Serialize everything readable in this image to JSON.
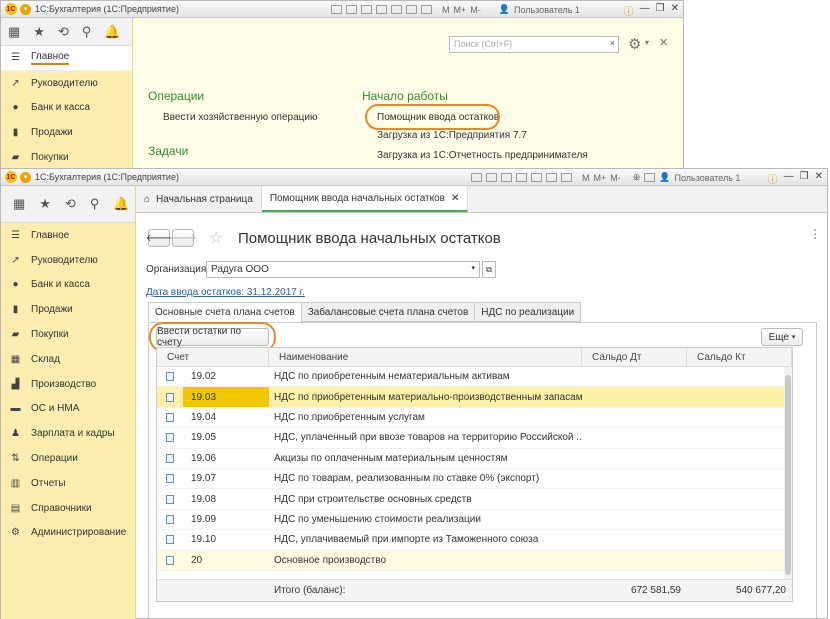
{
  "back_window": {
    "title": "1С:Бухгалтерия (1С:Предприятие)",
    "user": "Пользователь 1",
    "search_placeholder": "Поиск (Ctrl+F)",
    "sidebar": [
      "Главное",
      "Руководителю",
      "Банк и касса",
      "Продажи",
      "Покупки"
    ],
    "sections": {
      "operations_title": "Операции",
      "operations_link": "Ввести хозяйственную операцию",
      "tasks_title": "Задачи",
      "start_title": "Начало работы",
      "start_links": [
        "Помощник ввода остатков",
        "Загрузка из 1С:Предприятия 7.7",
        "Загрузка из 1С:Отчетность предпринимателя"
      ]
    }
  },
  "front_window": {
    "title": "1С:Бухгалтерия (1С:Предприятие)",
    "user": "Пользователь 1",
    "toolbar_text": [
      "M",
      "M+",
      "M-"
    ],
    "sidebar": [
      "Главное",
      "Руководителю",
      "Банк и касса",
      "Продажи",
      "Покупки",
      "Склад",
      "Производство",
      "ОС и НМА",
      "Зарплата и кадры",
      "Операции",
      "Отчеты",
      "Справочники",
      "Администрирование"
    ],
    "tabs": [
      "Начальная страница",
      "Помощник ввода начальных остатков"
    ],
    "page_title": "Помощник ввода начальных остатков",
    "org_label": "Организация:",
    "org_value": "Радуга ООО",
    "date_link": "Дата ввода остатков: 31.12.2017 г.",
    "subtabs": [
      "Основные счета плана счетов",
      "Забалансовые счета плана счетов",
      "НДС по реализации"
    ],
    "enter_button": "Ввести остатки по счету",
    "more_button": "Еще",
    "columns": [
      "Счет",
      "Наименование",
      "Сальдо Дт",
      "Сальдо Кт"
    ],
    "rows": [
      {
        "acc": "19.02",
        "name": "НДС по приобретенным нематериальным активам"
      },
      {
        "acc": "19.03",
        "name": "НДС по приобретенным материально-производственным запасам"
      },
      {
        "acc": "19.04",
        "name": "НДС по приобретенным услугам"
      },
      {
        "acc": "19.05",
        "name": "НДС, уплаченный при ввозе товаров на территорию Российской ..."
      },
      {
        "acc": "19.06",
        "name": "Акцизы по оплаченным материальным ценностям"
      },
      {
        "acc": "19.07",
        "name": "НДС по товарам, реализованным по ставке 0% (экспорт)"
      },
      {
        "acc": "19.08",
        "name": "НДС при строительстве основных средств"
      },
      {
        "acc": "19.09",
        "name": "НДС по уменьшению стоимости реализации"
      },
      {
        "acc": "19.10",
        "name": "НДС, уплачиваемый при импорте из Таможенного союза"
      },
      {
        "acc": "20",
        "name": "Основное производство"
      }
    ],
    "total_label": "Итого (баланс):",
    "total_dt": "672 581,59",
    "total_kt": "540 677,20"
  }
}
